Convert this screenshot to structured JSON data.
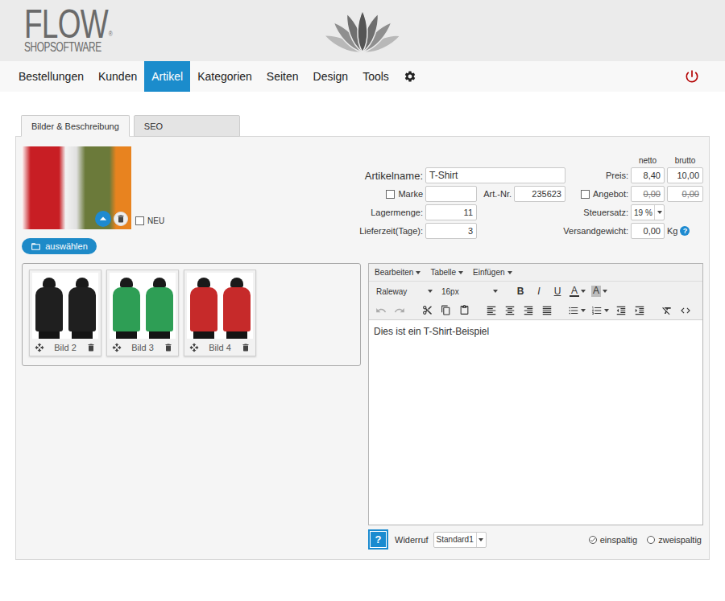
{
  "header": {
    "logo_title": "FLOW",
    "logo_mark": "®",
    "logo_subtitle": "SHOPSOFTWARE"
  },
  "nav": [
    {
      "label": "Bestellungen",
      "selected": false
    },
    {
      "label": "Kunden",
      "selected": false
    },
    {
      "label": "Artikel",
      "selected": true
    },
    {
      "label": "Kategorien",
      "selected": false
    },
    {
      "label": "Seiten",
      "selected": false
    },
    {
      "label": "Design",
      "selected": false
    },
    {
      "label": "Tools",
      "selected": false
    }
  ],
  "tabs": [
    {
      "label": "Bilder & Beschreibung",
      "selected": true
    },
    {
      "label": "SEO",
      "selected": false
    }
  ],
  "main_image": {
    "new_checkbox": {
      "label": "NEU",
      "checked": false
    }
  },
  "select_button": {
    "label": "auswählen"
  },
  "form": {
    "price_headers": [
      "netto",
      "brutto"
    ],
    "name": {
      "label": "Artikelname:",
      "value": "T-Shirt"
    },
    "brand": {
      "label": "Marke",
      "checked": false,
      "value": ""
    },
    "article_number": {
      "label": "Art.-Nr.",
      "value": "235623"
    },
    "stock": {
      "label": "Lagermenge:",
      "value": "11"
    },
    "delivery_time": {
      "label": "Lieferzeit(Tage):",
      "value": "3"
    },
    "price": {
      "label": "Preis:",
      "netto": "8,40",
      "brutto": "10,00"
    },
    "offer": {
      "label": "Angebot:",
      "checked": false,
      "netto": "0,00",
      "brutto": "0,00",
      "struck": true
    },
    "tax": {
      "label": "Steuersatz:",
      "value": "19 %"
    },
    "weight": {
      "label": "Versandgewicht:",
      "value": "0,00",
      "unit": "Kg",
      "help": "?"
    }
  },
  "gallery": [
    {
      "label": "Bild 2",
      "color": "#1f1f1f"
    },
    {
      "label": "Bild 3",
      "color": "#2e9e55"
    },
    {
      "label": "Bild 4",
      "color": "#c62a2a"
    }
  ],
  "editor": {
    "menus": [
      "Bearbeiten",
      "Tabelle",
      "Einfügen"
    ],
    "font": "Raleway",
    "size": "16px",
    "format_buttons": [
      {
        "label": "B",
        "kind": "bold"
      },
      {
        "label": "I",
        "kind": "italic"
      },
      {
        "label": "U",
        "kind": "underline"
      }
    ],
    "color_buttons": [
      {
        "label": "A",
        "kind": "text-color"
      },
      {
        "label": "A",
        "kind": "background-color"
      }
    ],
    "undo_disabled": true,
    "redo_disabled": true,
    "content": "Dies ist ein T-Shirt-Beispiel"
  },
  "footer": {
    "help": "?",
    "withdrawal_label": "Widerruf",
    "withdrawal_value": "Standard1",
    "layouts": [
      {
        "label": "einspaltig",
        "selected": true
      },
      {
        "label": "zweispaltig",
        "selected": false
      }
    ]
  }
}
